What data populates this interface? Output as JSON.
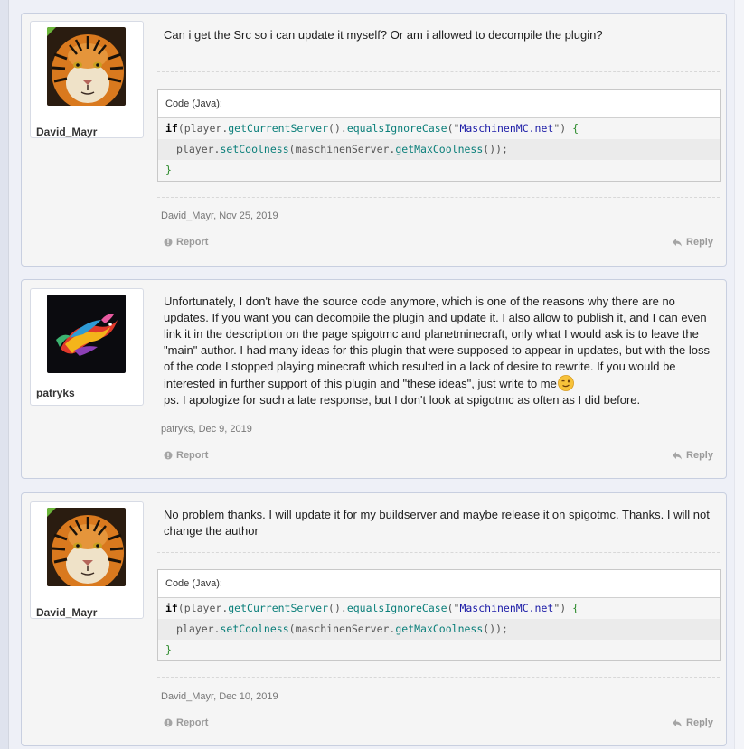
{
  "posts": [
    {
      "author": "David_Mayr",
      "avatar_icon": "tiger-avatar-icon",
      "message": "Can i get the Src so i can update it myself? Or am i allowed to decompile the plugin?",
      "code": {
        "header": "Code (Java):",
        "lines": [
          {
            "kw": "if",
            "p1": "(player.",
            "f1": "getCurrentServer",
            "p2": "().",
            "f2": "equalsIgnoreCase",
            "p3": "(\"",
            "s": "MaschinenMC.net",
            "p4": "\") ",
            "b": "{"
          },
          {
            "p1": "player.",
            "f1": "setCoolness",
            "p2": "(maschinenServer.",
            "f2": "getMaxCoolness",
            "p3": "());"
          },
          {
            "b": "}"
          }
        ]
      },
      "meta": "David_Mayr, Nov 25, 2019",
      "report_label": "Report",
      "reply_label": "Reply"
    },
    {
      "author": "patryks",
      "avatar_icon": "dragon-avatar-icon",
      "message": "Unfortunately, I don't have the source code anymore, which is one of the reasons why there are no updates. If you want you can decompile the plugin and update it. I also allow to publish it, and I can even link it in the description on the page spigotmc and planetminecraft, only what I would ask is to leave the \"main\" author. I had many ideas for this plugin that were supposed to appear in updates, but with the loss of the code I stopped playing minecraft which resulted in a lack of desire to rewrite. If you would be interested in further support of this plugin and \"these ideas\", just write to me",
      "message_ps": "ps. I apologize for such a late response, but I don't look at spigotmc as often as I did before.",
      "emoji_icon": "wink-emoji-icon",
      "meta": "patryks, Dec 9, 2019",
      "report_label": "Report",
      "reply_label": "Reply"
    },
    {
      "author": "David_Mayr",
      "avatar_icon": "tiger-avatar-icon",
      "message": "No problem thanks. I will update it for my buildserver and maybe release it on spigotmc. Thanks. I will not change the author",
      "code": {
        "header": "Code (Java):",
        "lines": [
          {
            "kw": "if",
            "p1": "(player.",
            "f1": "getCurrentServer",
            "p2": "().",
            "f2": "equalsIgnoreCase",
            "p3": "(\"",
            "s": "MaschinenMC.net",
            "p4": "\") ",
            "b": "{"
          },
          {
            "p1": "player.",
            "f1": "setCoolness",
            "p2": "(maschinenServer.",
            "f2": "getMaxCoolness",
            "p3": "());"
          },
          {
            "b": "}"
          }
        ]
      },
      "meta": "David_Mayr, Dec 10, 2019",
      "report_label": "Report",
      "reply_label": "Reply"
    }
  ],
  "colors": {
    "page_bg": "#eef0f7",
    "post_bg": "#f5f5f5",
    "code_function": "#0b7f7a",
    "code_string": "#1a1aa6",
    "code_brace": "#2b8a2b",
    "action_gray": "#9a9a9a"
  }
}
